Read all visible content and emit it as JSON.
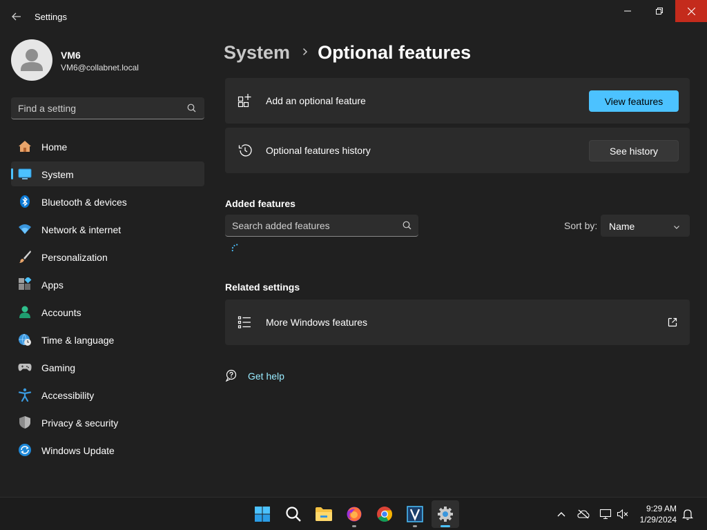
{
  "window": {
    "title": "Settings"
  },
  "profile": {
    "name": "VM6",
    "email": "VM6@collabnet.local"
  },
  "sidebar": {
    "search_placeholder": "Find a setting",
    "items": [
      {
        "label": "Home",
        "icon": "home-icon"
      },
      {
        "label": "System",
        "icon": "system-icon",
        "active": true
      },
      {
        "label": "Bluetooth & devices",
        "icon": "bluetooth-icon"
      },
      {
        "label": "Network & internet",
        "icon": "wifi-icon"
      },
      {
        "label": "Personalization",
        "icon": "brush-icon"
      },
      {
        "label": "Apps",
        "icon": "apps-icon"
      },
      {
        "label": "Accounts",
        "icon": "accounts-icon"
      },
      {
        "label": "Time & language",
        "icon": "globe-clock-icon"
      },
      {
        "label": "Gaming",
        "icon": "gamepad-icon"
      },
      {
        "label": "Accessibility",
        "icon": "accessibility-icon"
      },
      {
        "label": "Privacy & security",
        "icon": "shield-icon"
      },
      {
        "label": "Windows Update",
        "icon": "update-icon"
      }
    ]
  },
  "breadcrumb": {
    "parent": "System",
    "current": "Optional features"
  },
  "cards": {
    "add": {
      "label": "Add an optional feature",
      "button": "View features"
    },
    "history": {
      "label": "Optional features history",
      "button": "See history"
    }
  },
  "added_features": {
    "title": "Added features",
    "search_placeholder": "Search added features",
    "sort_label": "Sort by:",
    "sort_value": "Name"
  },
  "related": {
    "title": "Related settings",
    "more_label": "More Windows features"
  },
  "help": {
    "label": "Get help"
  },
  "taskbar": {
    "time": "9:29 AM",
    "date": "1/29/2024"
  },
  "colors": {
    "accent": "#4cc2ff",
    "background": "#202020",
    "card": "#2b2b2b",
    "close": "#c42b1c",
    "link": "#99ebff"
  }
}
